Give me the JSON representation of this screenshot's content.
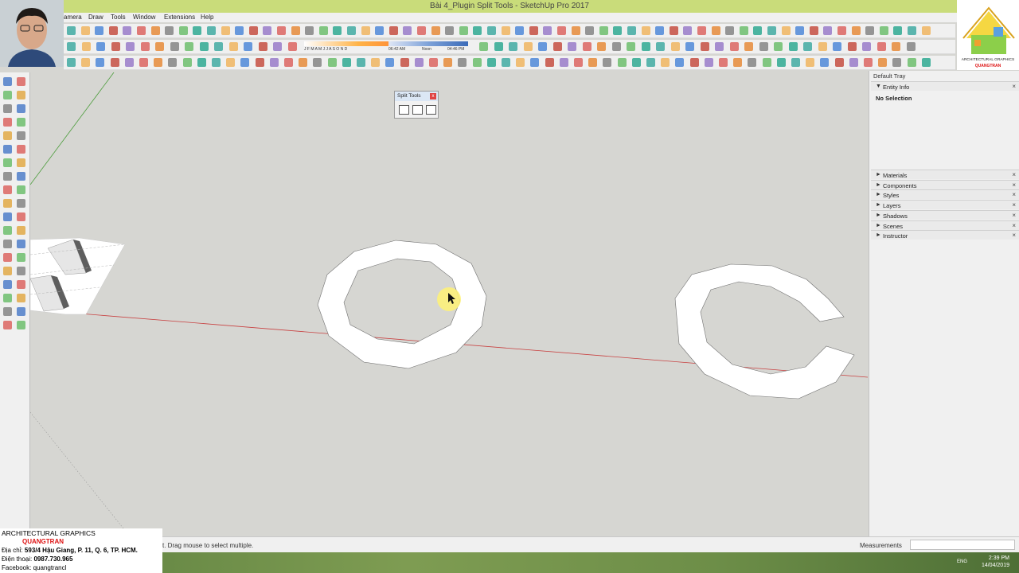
{
  "window": {
    "title": "Bài 4_Plugin Split Tools - SketchUp Pro 2017"
  },
  "menu": [
    "amera",
    "Draw",
    "Tools",
    "Window",
    "Extensions",
    "Help"
  ],
  "toolbar": {
    "shadow_months": "J F M A M J J A S O N D",
    "time_start": "06:42 AM",
    "time_noon": "Noon",
    "time_end": "04:46 PM"
  },
  "split_tools_panel": {
    "title": "Split Tools",
    "close": "x"
  },
  "tray": {
    "title": "Default Tray",
    "entity_info": {
      "label": "Entity Info",
      "value": "No Selection"
    },
    "panels": [
      "Materials",
      "Components",
      "Styles",
      "Layers",
      "Shadows",
      "Scenes",
      "Instructor"
    ]
  },
  "status": {
    "hint": "t. Drag mouse to select multiple.",
    "measurements_label": "Measurements"
  },
  "taskbar": {
    "lang": "ENG",
    "time": "2:39 PM",
    "date": "14/04/2019"
  },
  "branding": {
    "logo_line1": "ARCHITECTURAL GRAPHICS",
    "logo_line2": "QUANGTRAN",
    "info_title": "ARCHITECTURAL GRAPHICS",
    "info_name": "QUANGTRAN",
    "info_address_label": "Địa chỉ:",
    "info_address": "593/4 Hậu Giang, P. 11, Q. 6, TP. HCM.",
    "info_phone_label": "Điện thoại:",
    "info_phone": "0987.730.965",
    "info_facebook": "Facebook: quangtrancl"
  },
  "colors": {
    "title_bar": "#c9dc7a",
    "viewport_bg": "#d6d6d2",
    "axis_red": "#c84040",
    "axis_green": "#4a9c3a",
    "cursor_highlight": "#fff275"
  }
}
